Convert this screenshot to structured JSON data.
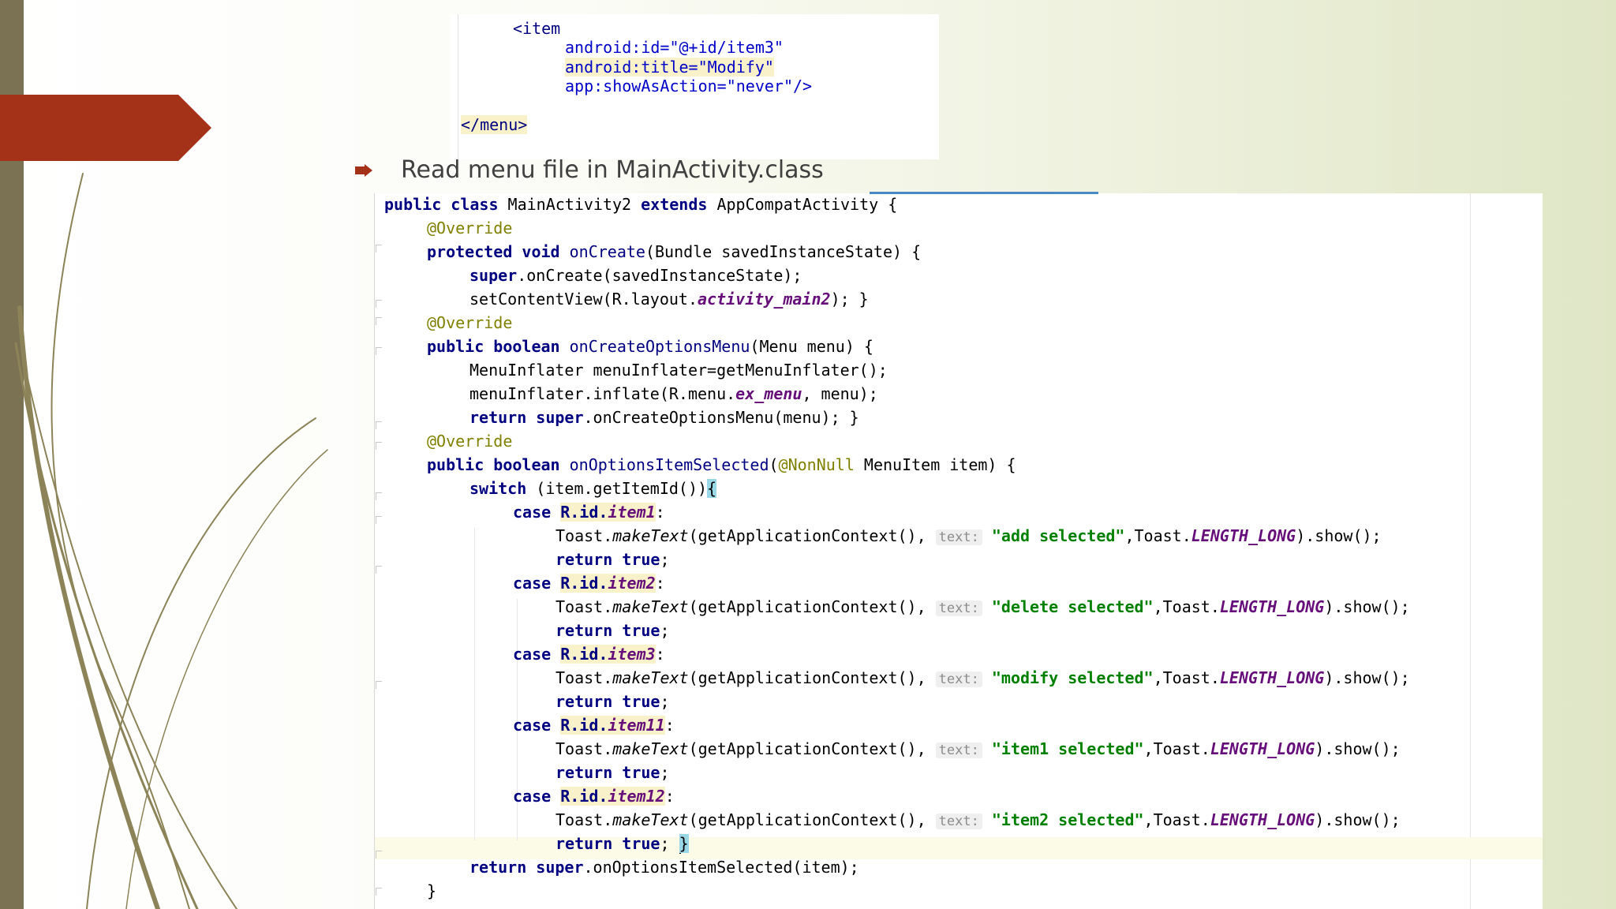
{
  "snippet": {
    "lines": [
      "<item",
      "android:id=\"@+id/item3\"",
      "android:title=\"Modify\"",
      "app:showAsAction=\"never\"/>",
      "</menu>"
    ]
  },
  "bullet": {
    "text": "Read menu file in MainActivity.class"
  },
  "code": {
    "l1": [
      "public class",
      " MainActivity2 ",
      "extends",
      " AppCompatActivity {"
    ],
    "override": "@Override",
    "l3": [
      "protected void",
      " onCreate",
      "(Bundle savedInstanceState) {"
    ],
    "l4": [
      "super",
      ".onCreate(savedInstanceState);"
    ],
    "l5": [
      "setContentView(R.layout.",
      "activity_main2",
      "); }"
    ],
    "l7": [
      "public boolean",
      " onCreateOptionsMenu",
      "(Menu menu) {"
    ],
    "l8": "MenuInflater menuInflater=getMenuInflater();",
    "l9": [
      "menuInflater.inflate(R.menu.",
      "ex_menu",
      ", menu);"
    ],
    "l10": [
      "return super",
      ".onCreateOptionsMenu(menu); }"
    ],
    "l12": [
      "public boolean",
      " onOptionsItemSelected",
      "(",
      "@NonNull",
      " MenuItem item) {"
    ],
    "l13": [
      "switch",
      " (item.getItemId())",
      "{"
    ],
    "case_kw": "case",
    "rid": "R.id.",
    "colon": ":",
    "toast": "Toast.",
    "make_text": "makeText",
    "get_ctx": "(getApplicationContext(), ",
    "hint": "text:",
    "comma_toast": ",Toast.",
    "length_long": "LENGTH_LONG",
    "show": ").show();",
    "return_true": [
      "return",
      " true",
      ";"
    ],
    "cases": [
      {
        "item": "item1",
        "msg": "\"add selected\""
      },
      {
        "item": "item2",
        "msg": "\"delete selected\""
      },
      {
        "item": "item3",
        "msg": "\"modify selected\""
      },
      {
        "item": "item11",
        "msg": "\"item1 selected\""
      },
      {
        "item": "item12",
        "msg": "\"item2 selected\""
      }
    ],
    "last_brace": "}",
    "l29": [
      "return super",
      ".onOptionsItemSelected(item);"
    ],
    "l30": "}"
  },
  "colors": {
    "side_bar": "#7b7254",
    "accent_red": "#a33218",
    "swirl": "#8c8458",
    "keyword": "#000080",
    "string": "#008000",
    "annotation": "#808000",
    "field": "#660e7a"
  }
}
